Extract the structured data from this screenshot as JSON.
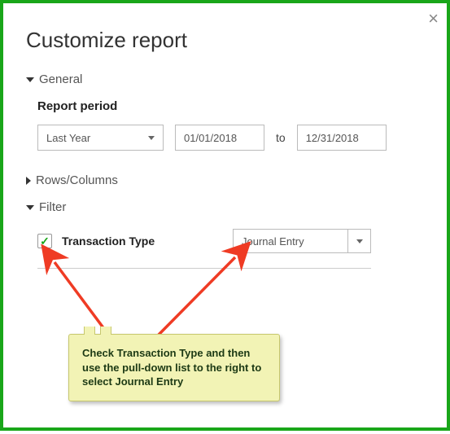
{
  "title": "Customize report",
  "sections": {
    "general": {
      "label": "General",
      "expanded": true
    },
    "rows_columns": {
      "label": "Rows/Columns",
      "expanded": false
    },
    "filter": {
      "label": "Filter",
      "expanded": true
    }
  },
  "report_period": {
    "label": "Report period",
    "preset": "Last Year",
    "from": "01/01/2018",
    "to_label": "to",
    "to": "12/31/2018"
  },
  "filter_row": {
    "checked": true,
    "label": "Transaction Type",
    "value": "Journal Entry"
  },
  "callout": {
    "text": "Check Transaction Type and then use the pull-down list to the right to select Journal Entry"
  }
}
